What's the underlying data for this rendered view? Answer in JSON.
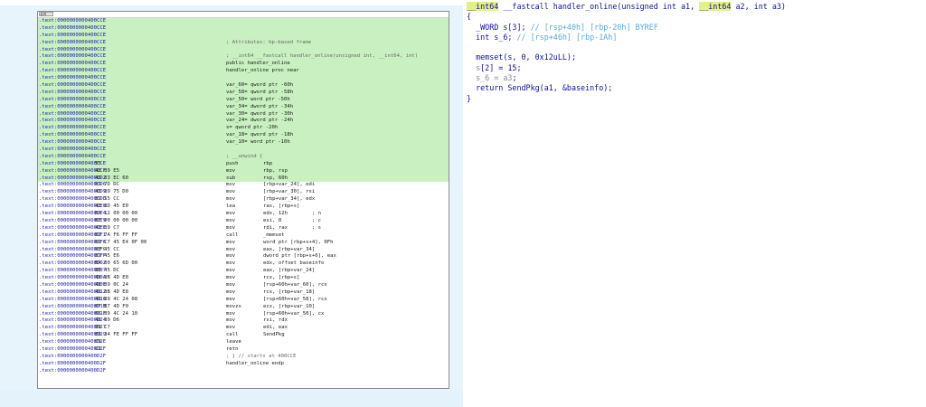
{
  "disasm_view": {
    "title_tab": "IDA",
    "lines": [
      {
        "addr": ".text:0000000000400CCE",
        "bytes": "",
        "mnemonic": "",
        "operand": "",
        "text": "",
        "hl": true
      },
      {
        "addr": ".text:0000000000400CCE",
        "bytes": "",
        "mnemonic": "",
        "operand": "",
        "text": "",
        "hl": true
      },
      {
        "addr": ".text:0000000000400CCE",
        "bytes": "",
        "mnemonic": "",
        "operand": "",
        "text": "",
        "hl": true
      },
      {
        "addr": ".text:0000000000400CCE",
        "bytes": "",
        "mnemonic": "",
        "operand": "",
        "text": "; Attributes: bp-based frame",
        "hl": true,
        "comment": true
      },
      {
        "addr": ".text:0000000000400CCE",
        "bytes": "",
        "mnemonic": "",
        "operand": "",
        "text": "",
        "hl": true
      },
      {
        "addr": ".text:0000000000400CCE",
        "bytes": "",
        "mnemonic": "",
        "operand": "",
        "text": "; __int64 __fastcall handler_online(unsigned int, __int64, int)",
        "hl": true,
        "comment": true
      },
      {
        "addr": ".text:0000000000400CCE",
        "bytes": "",
        "mnemonic": "",
        "operand": "",
        "text": "public handler_online",
        "hl": true
      },
      {
        "addr": ".text:0000000000400CCE",
        "bytes": "",
        "mnemonic": "",
        "operand": "",
        "text": "handler_online proc near",
        "hl": true
      },
      {
        "addr": ".text:0000000000400CCE",
        "bytes": "",
        "mnemonic": "",
        "operand": "",
        "text": "",
        "hl": true
      },
      {
        "addr": ".text:0000000000400CCE",
        "bytes": "",
        "mnemonic": "",
        "operand": "",
        "text": "var_60= qword ptr -60h",
        "hl": true
      },
      {
        "addr": ".text:0000000000400CCE",
        "bytes": "",
        "mnemonic": "",
        "operand": "",
        "text": "var_58= qword ptr -58h",
        "hl": true
      },
      {
        "addr": ".text:0000000000400CCE",
        "bytes": "",
        "mnemonic": "",
        "operand": "",
        "text": "var_50= word ptr -50h",
        "hl": true
      },
      {
        "addr": ".text:0000000000400CCE",
        "bytes": "",
        "mnemonic": "",
        "operand": "",
        "text": "var_34= dword ptr -34h",
        "hl": true
      },
      {
        "addr": ".text:0000000000400CCE",
        "bytes": "",
        "mnemonic": "",
        "operand": "",
        "text": "var_30= qword ptr -30h",
        "hl": true
      },
      {
        "addr": ".text:0000000000400CCE",
        "bytes": "",
        "mnemonic": "",
        "operand": "",
        "text": "var_24= dword ptr -24h",
        "hl": true
      },
      {
        "addr": ".text:0000000000400CCE",
        "bytes": "",
        "mnemonic": "",
        "operand": "",
        "text": "s= qword ptr -20h",
        "hl": true
      },
      {
        "addr": ".text:0000000000400CCE",
        "bytes": "",
        "mnemonic": "",
        "operand": "",
        "text": "var_18= qword ptr -18h",
        "hl": true
      },
      {
        "addr": ".text:0000000000400CCE",
        "bytes": "",
        "mnemonic": "",
        "operand": "",
        "text": "var_10= word ptr -10h",
        "hl": true
      },
      {
        "addr": ".text:0000000000400CCE",
        "bytes": "",
        "mnemonic": "",
        "operand": "",
        "text": "",
        "hl": true
      },
      {
        "addr": ".text:0000000000400CCE",
        "bytes": "",
        "mnemonic": "",
        "operand": "",
        "text": "; __unwind {",
        "hl": true,
        "comment": true
      },
      {
        "addr": ".text:0000000000400CCE",
        "bytes": "55",
        "mnemonic": "push",
        "operand": "rbp",
        "text": "",
        "hl": true
      },
      {
        "addr": ".text:0000000000400CCF",
        "bytes": "48 89 E5",
        "mnemonic": "mov",
        "operand": "rbp, rsp",
        "text": "",
        "hl": true
      },
      {
        "addr": ".text:0000000000400CD2",
        "bytes": "48 83 EC 60",
        "mnemonic": "sub",
        "operand": "rsp, 60h",
        "text": "",
        "hl": true
      },
      {
        "addr": ".text:0000000000400CD6",
        "bytes": "89 7D DC",
        "mnemonic": "mov",
        "operand": "[rbp+var_24], edi",
        "text": "",
        "hl": false
      },
      {
        "addr": ".text:0000000000400CD9",
        "bytes": "48 89 75 D0",
        "mnemonic": "mov",
        "operand": "[rbp+var_30], rsi",
        "text": "",
        "hl": false
      },
      {
        "addr": ".text:0000000000400CDD",
        "bytes": "89 55 CC",
        "mnemonic": "mov",
        "operand": "[rbp+var_34], edx",
        "text": "",
        "hl": false
      },
      {
        "addr": ".text:0000000000400CE0",
        "bytes": "48 8D 45 E0",
        "mnemonic": "lea",
        "operand": "rax, [rbp+s]",
        "text": "",
        "hl": false
      },
      {
        "addr": ".text:0000000000400CE4",
        "bytes": "BA 12 00 00 00",
        "mnemonic": "mov",
        "operand": "edx, 12h        ; n",
        "text": "",
        "hl": false
      },
      {
        "addr": ".text:0000000000400CE9",
        "bytes": "BE 00 00 00 00",
        "mnemonic": "mov",
        "operand": "esi, 0          ; c",
        "text": "",
        "hl": false
      },
      {
        "addr": ".text:0000000000400CEE",
        "bytes": "48 89 C7",
        "mnemonic": "mov",
        "operand": "rdi, rax        ; s",
        "text": "",
        "hl": false
      },
      {
        "addr": ".text:0000000000400CF1",
        "bytes": "E8 7A F6 FF FF",
        "mnemonic": "call",
        "operand": "_memset",
        "text": "",
        "hl": false
      },
      {
        "addr": ".text:0000000000400CF6",
        "bytes": "66 C7 45 E4 0F 00",
        "mnemonic": "mov",
        "operand": "word ptr [rbp+s+4], 0Fh",
        "text": "",
        "hl": false
      },
      {
        "addr": ".text:0000000000400CFC",
        "bytes": "8B 45 CC",
        "mnemonic": "mov",
        "operand": "eax, [rbp+var_34]",
        "text": "",
        "hl": false
      },
      {
        "addr": ".text:0000000000400CFF",
        "bytes": "89 45 E6",
        "mnemonic": "mov",
        "operand": "dword ptr [rbp+s+6], eax",
        "text": "",
        "hl": false
      },
      {
        "addr": ".text:0000000000400D02",
        "bytes": "BA 00 65 6D 00",
        "mnemonic": "mov",
        "operand": "edx, offset baseinfo",
        "text": "",
        "hl": false
      },
      {
        "addr": ".text:0000000000400D07",
        "bytes": "8B 45 DC",
        "mnemonic": "mov",
        "operand": "eax, [rbp+var_24]",
        "text": "",
        "hl": false
      },
      {
        "addr": ".text:0000000000400D0A",
        "bytes": "48 8B 4D E0",
        "mnemonic": "mov",
        "operand": "rcx, [rbp+s]",
        "text": "",
        "hl": false
      },
      {
        "addr": ".text:0000000000400D0E",
        "bytes": "48 89 0C 24",
        "mnemonic": "mov",
        "operand": "[rsp+60h+var_60], rcx",
        "text": "",
        "hl": false
      },
      {
        "addr": ".text:0000000000400D12",
        "bytes": "48 8B 4D E8",
        "mnemonic": "mov",
        "operand": "rcx, [rbp+var_18]",
        "text": "",
        "hl": false
      },
      {
        "addr": ".text:0000000000400D16",
        "bytes": "48 89 4C 24 08",
        "mnemonic": "mov",
        "operand": "[rsp+60h+var_58], rcx",
        "text": "",
        "hl": false
      },
      {
        "addr": ".text:0000000000400D1B",
        "bytes": "0F B7 4D F0",
        "mnemonic": "movzx",
        "operand": "ecx, [rbp+var_10]",
        "text": "",
        "hl": false
      },
      {
        "addr": ".text:0000000000400D1F",
        "bytes": "66 89 4C 24 10",
        "mnemonic": "mov",
        "operand": "[rsp+60h+var_50], cx",
        "text": "",
        "hl": false
      },
      {
        "addr": ".text:0000000000400D24",
        "bytes": "48 89 D6",
        "mnemonic": "mov",
        "operand": "rsi, rdx",
        "text": "",
        "hl": false
      },
      {
        "addr": ".text:0000000000400D27",
        "bytes": "89 C7",
        "mnemonic": "mov",
        "operand": "edi, eax",
        "text": "",
        "hl": false
      },
      {
        "addr": ".text:0000000000400D29",
        "bytes": "E8 34 FE FF FF",
        "mnemonic": "call",
        "operand": "SendPkg",
        "text": "",
        "hl": false
      },
      {
        "addr": ".text:0000000000400D2E",
        "bytes": "C9",
        "mnemonic": "leave",
        "operand": "",
        "text": "",
        "hl": false
      },
      {
        "addr": ".text:0000000000400D2F",
        "bytes": "C3",
        "mnemonic": "retn",
        "operand": "",
        "text": "",
        "hl": false
      },
      {
        "addr": ".text:0000000000400D2F",
        "bytes": "",
        "mnemonic": "",
        "operand": "",
        "text": "; } // starts at 400CCE",
        "hl": false,
        "comment": true
      },
      {
        "addr": ".text:0000000000400D2F",
        "bytes": "",
        "mnemonic": "",
        "operand": "",
        "text": "handler_online endp",
        "hl": false
      },
      {
        "addr": ".text:0000000000400D2F",
        "bytes": "",
        "mnemonic": "",
        "operand": "",
        "text": "",
        "hl": false
      }
    ]
  },
  "pseudocode_view": {
    "header_type": "__int64",
    "header_mid": " __fastcall handler_online(unsigned int a1, ",
    "header_type2": "__int64",
    "header_end": " a2, int a3)",
    "open_brace": "{",
    "decl1_code": "  _WORD s[3]; ",
    "decl1_comment": "// [rsp+40h] [rbp-20h] BYREF",
    "decl2_code": "  int s_6; ",
    "decl2_comment": "// [rsp+46h] [rbp-1Ah]",
    "blank": "",
    "stmt1": "  memset(s, 0, 0x12uLL);",
    "stmt2_var": "s",
    "stmt2_rest": "[2] = 15;",
    "stmt3_var": "s_6 = a3",
    "stmt3_rest": ";",
    "stmt4": "  return SendPkg(a1, &baseinfo);",
    "close_brace": "}"
  }
}
